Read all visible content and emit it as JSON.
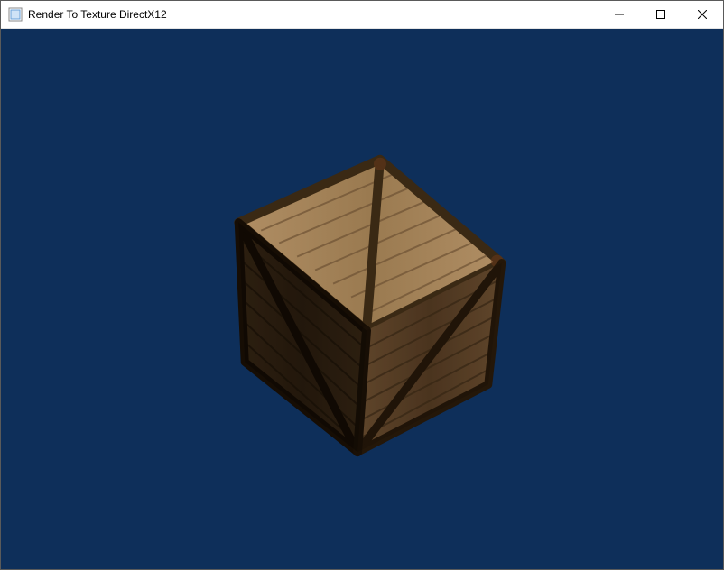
{
  "window": {
    "title": "Render To Texture DirectX12",
    "icons": {
      "app": "app-icon",
      "minimize": "minimize-icon",
      "maximize": "maximize-icon",
      "close": "close-icon"
    }
  },
  "viewport": {
    "background_color": "#0e2f5a",
    "object": "wooden-crate-cube",
    "crate": {
      "wood_light": "#a8865e",
      "wood_mid": "#8a6a44",
      "wood_dark": "#5e4228",
      "edge_dark": "#2f2012",
      "rust": "#6b3a1a"
    }
  }
}
